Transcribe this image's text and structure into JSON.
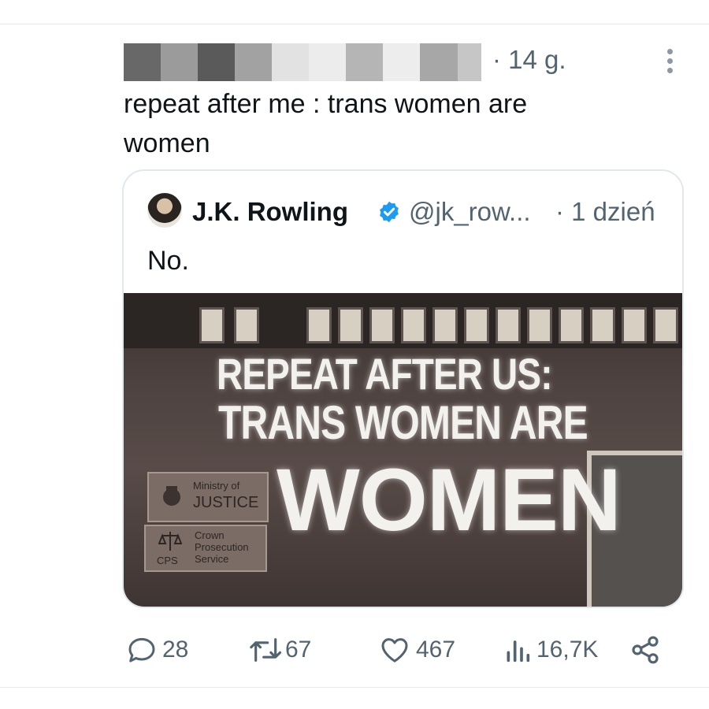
{
  "tweet": {
    "timestamp": "· 14 g.",
    "text": "repeat after me : trans women are women",
    "author_redacted": true
  },
  "quoted_tweet": {
    "name": "J.K. Rowling",
    "handle": "@jk_row...",
    "time": "· 1 dzień",
    "text": "No.",
    "verified": true,
    "image": {
      "sign_lines": [
        "REPEAT AFTER US:",
        "TRANS WOMEN ARE",
        "WOMEN"
      ],
      "plaque_top": [
        "Ministry of",
        "JUSTICE"
      ],
      "plaque_bottom": [
        "Crown",
        "Prosecution",
        "Service",
        "CPS"
      ]
    }
  },
  "actions": {
    "replies": "28",
    "reposts": "67",
    "likes": "467",
    "views": "16,7K"
  },
  "colors": {
    "text": "#0f1419",
    "secondary": "#536471",
    "verified": "#1d9bf0",
    "border": "#e1e8ed"
  },
  "icons": [
    "more-dots-icon",
    "verified-badge-icon",
    "reply-icon",
    "repost-icon",
    "like-icon",
    "views-icon",
    "share-icon"
  ]
}
